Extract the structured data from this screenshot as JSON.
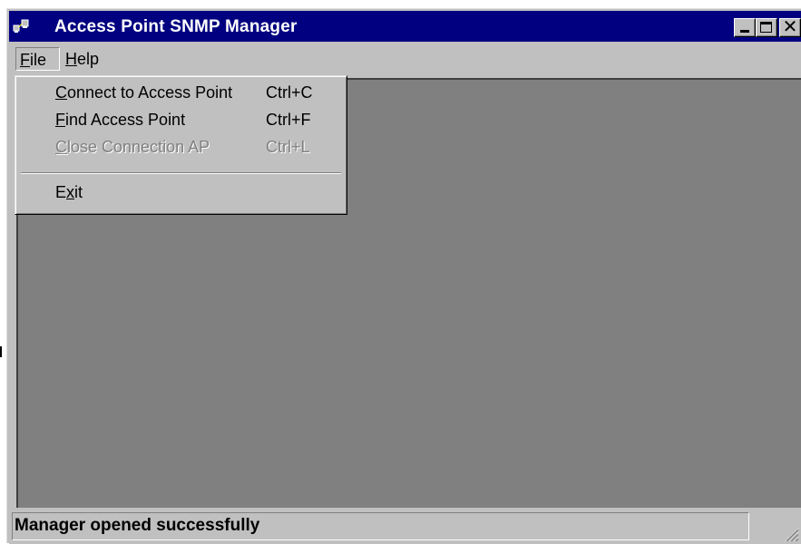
{
  "window": {
    "title": "Access Point SNMP Manager"
  },
  "menubar": {
    "file_label": "File",
    "file_mnemonic": "F",
    "file_rest": "ile",
    "help_label": "Help",
    "help_mnemonic": "H",
    "help_rest": "elp"
  },
  "file_menu": {
    "items": [
      {
        "label": "Connect to Access Point",
        "mnemonic": "C",
        "rest": "onnect to Access Point",
        "shortcut": "Ctrl+C",
        "enabled": true
      },
      {
        "label": "Find Access Point",
        "mnemonic": "F",
        "rest": "ind Access Point",
        "shortcut": "Ctrl+F",
        "enabled": true
      },
      {
        "label": "Close Connection AP",
        "mnemonic": "C",
        "rest": "lose Connection AP",
        "shortcut": "Ctrl+L",
        "enabled": false
      }
    ],
    "exit": {
      "label": "Exit",
      "pre": "E",
      "mnemonic": "x",
      "rest": "it"
    }
  },
  "statusbar": {
    "text": "Manager opened successfully"
  },
  "colors": {
    "titlebar": "#000080",
    "face": "#c0c0c0",
    "client": "#808080",
    "disabled_text": "#808080"
  },
  "icons": {
    "app": "network-computers-icon",
    "minimize": "minimize-icon",
    "maximize": "maximize-icon",
    "close": "close-icon",
    "grip": "resize-grip-icon"
  }
}
